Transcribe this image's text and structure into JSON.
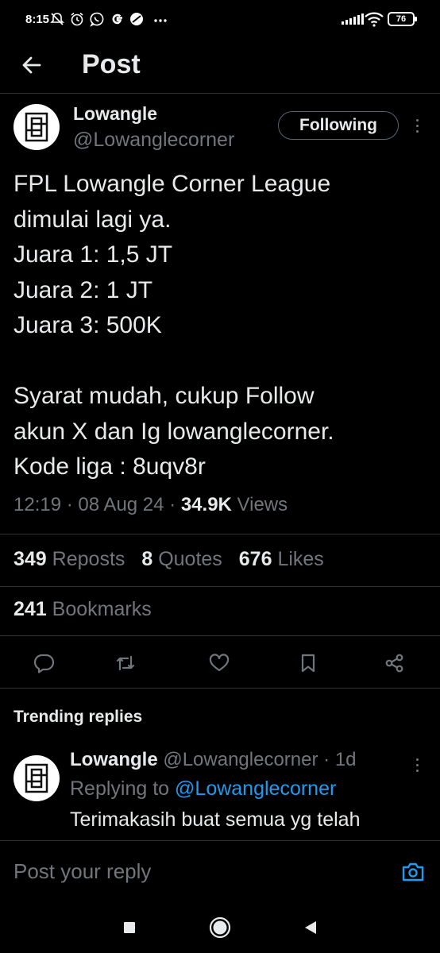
{
  "status_bar": {
    "time": "8:15",
    "battery": "76",
    "notif_icons": [
      "mute-icon",
      "alarm-icon",
      "whatsapp-icon",
      "google-icon",
      "app-icon",
      "more-dots-icon"
    ]
  },
  "header": {
    "title": "Post"
  },
  "post": {
    "author": {
      "name": "Lowangle",
      "handle": "@Lowanglecorner",
      "follow_label": "Following"
    },
    "text_lines": [
      "FPL Lowangle Corner League",
      "dimulai lagi ya.",
      "Juara 1: 1,5 JT",
      "Juara 2: 1 JT",
      "Juara 3: 500K",
      "",
      "Syarat mudah, cukup Follow",
      "akun X dan Ig lowanglecorner.",
      "Kode liga : 8uqv8r"
    ],
    "meta": {
      "time": "12:19",
      "date": "08 Aug 24",
      "views_count": "34.9K",
      "views_label": "Views"
    },
    "stats": {
      "reposts_count": "349",
      "reposts_label": "Reposts",
      "quotes_count": "8",
      "quotes_label": "Quotes",
      "likes_count": "676",
      "likes_label": "Likes",
      "bookmarks_count": "241",
      "bookmarks_label": "Bookmarks"
    }
  },
  "trending": {
    "title": "Trending replies",
    "reply": {
      "name": "Lowangle",
      "handle": "@Lowanglecorner",
      "age": "1d",
      "replying_prefix": "Replying to",
      "replying_to": "@Lowanglecorner",
      "text": "Terimakasih buat semua yg telah"
    }
  },
  "composer": {
    "placeholder": "Post your reply"
  },
  "colors": {
    "background": "#000000",
    "text": "#e7e9ea",
    "muted": "#71767b",
    "accent": "#1d9bf0",
    "divider": "#2f3336"
  }
}
